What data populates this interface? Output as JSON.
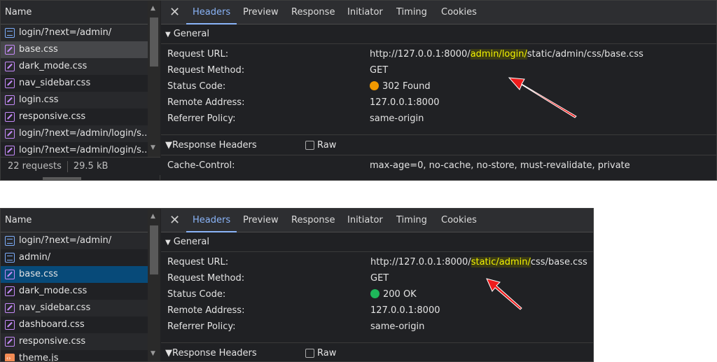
{
  "panels": [
    {
      "list": {
        "header": "Name",
        "items": [
          {
            "label": "login/?next=/admin/",
            "type": "doc"
          },
          {
            "label": "base.css",
            "type": "css",
            "selected": "grey"
          },
          {
            "label": "dark_mode.css",
            "type": "css"
          },
          {
            "label": "nav_sidebar.css",
            "type": "css"
          },
          {
            "label": "login.css",
            "type": "css"
          },
          {
            "label": "responsive.css",
            "type": "css"
          },
          {
            "label": "login/?next=/admin/login/s...",
            "type": "css"
          },
          {
            "label": "login/?next=/admin/login/s...",
            "type": "css"
          }
        ],
        "footer": {
          "requests": "22 requests",
          "transferred": "29.5 kB transferred"
        }
      },
      "tabs": [
        "Headers",
        "Preview",
        "Response",
        "Initiator",
        "Timing",
        "Cookies"
      ],
      "general": {
        "title": "General",
        "labels": [
          "Request URL:",
          "Request Method:",
          "Status Code:",
          "Remote Address:",
          "Referrer Policy:"
        ],
        "url_pre": "http://127.0.0.1:8000/",
        "url_hl": "admin/login/",
        "url_post": "static/admin/css/base.css",
        "method": "GET",
        "status": "302 Found",
        "status_color": "#f29900",
        "remote": "127.0.0.1:8000",
        "referrer": "same-origin"
      },
      "response_headers": {
        "title": "Response Headers",
        "raw": "Raw",
        "rows": [
          {
            "k": "Cache-Control:",
            "v": "max-age=0, no-cache, no-store, must-revalidate, private"
          }
        ]
      }
    },
    {
      "list": {
        "header": "Name",
        "items": [
          {
            "label": "login/?next=/admin/",
            "type": "doc"
          },
          {
            "label": "admin/",
            "type": "doc"
          },
          {
            "label": "base.css",
            "type": "css",
            "selected": "blue"
          },
          {
            "label": "dark_mode.css",
            "type": "css"
          },
          {
            "label": "nav_sidebar.css",
            "type": "css"
          },
          {
            "label": "dashboard.css",
            "type": "css"
          },
          {
            "label": "responsive.css",
            "type": "css"
          },
          {
            "label": "theme.js",
            "type": "js"
          }
        ]
      },
      "tabs": [
        "Headers",
        "Preview",
        "Response",
        "Initiator",
        "Timing",
        "Cookies"
      ],
      "general": {
        "title": "General",
        "labels": [
          "Request URL:",
          "Request Method:",
          "Status Code:",
          "Remote Address:",
          "Referrer Policy:"
        ],
        "url_pre": "http://127.0.0.1:8000/",
        "url_hl": "static/admin/",
        "url_post": "css/base.css",
        "method": "GET",
        "status": "200 OK",
        "status_color": "#1eb85a",
        "remote": "127.0.0.1:8000",
        "referrer": "same-origin"
      },
      "response_headers": {
        "title": "Response Headers",
        "raw": "Raw",
        "rows": []
      }
    }
  ]
}
